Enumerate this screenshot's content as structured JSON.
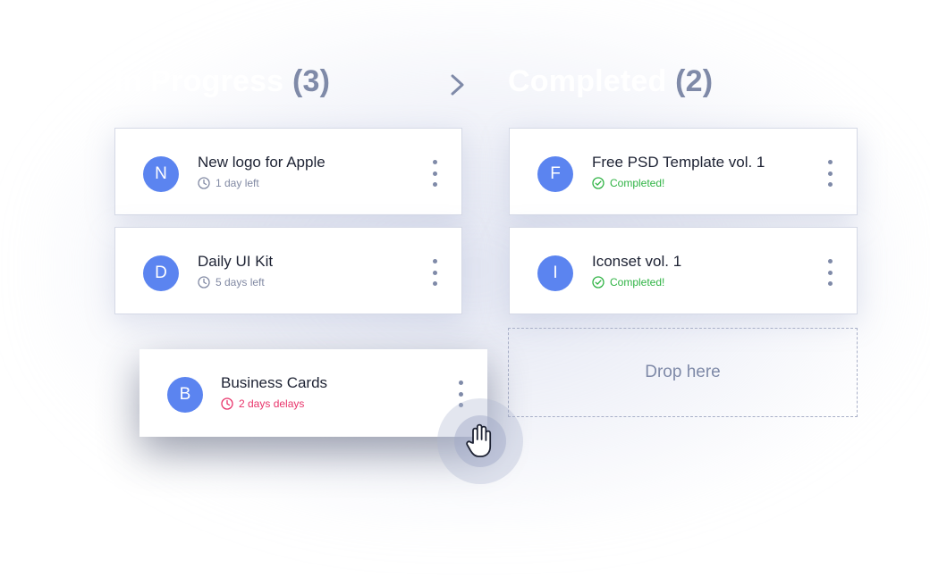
{
  "board": {
    "columns": [
      {
        "title": "In Progress",
        "count": "(3)",
        "cards": [
          {
            "initial": "N",
            "title": "New logo for Apple",
            "status": "1 day left"
          },
          {
            "initial": "D",
            "title": "Daily UI Kit",
            "status": "5 days left"
          }
        ]
      },
      {
        "title": "Completed",
        "count": "(2)",
        "cards": [
          {
            "initial": "F",
            "title": "Free PSD Template vol. 1",
            "status": "Completed!"
          },
          {
            "initial": "I",
            "title": "Iconset vol. 1",
            "status": "Completed!"
          }
        ]
      }
    ],
    "dragging_card": {
      "initial": "B",
      "title": "Business Cards",
      "status": "2 days delays"
    },
    "drop_zone_label": "Drop here"
  },
  "colors": {
    "avatar": "#5b84f0",
    "count": "#7f8aa8",
    "completed": "#2fb344",
    "delay": "#e8336a",
    "muted": "#8189a3"
  },
  "icons": {
    "move_arrow": "chevron-right-icon",
    "time": "clock-icon",
    "done": "check-circle-icon",
    "menu": "more-vertical-icon",
    "cursor": "grab-hand-icon"
  }
}
